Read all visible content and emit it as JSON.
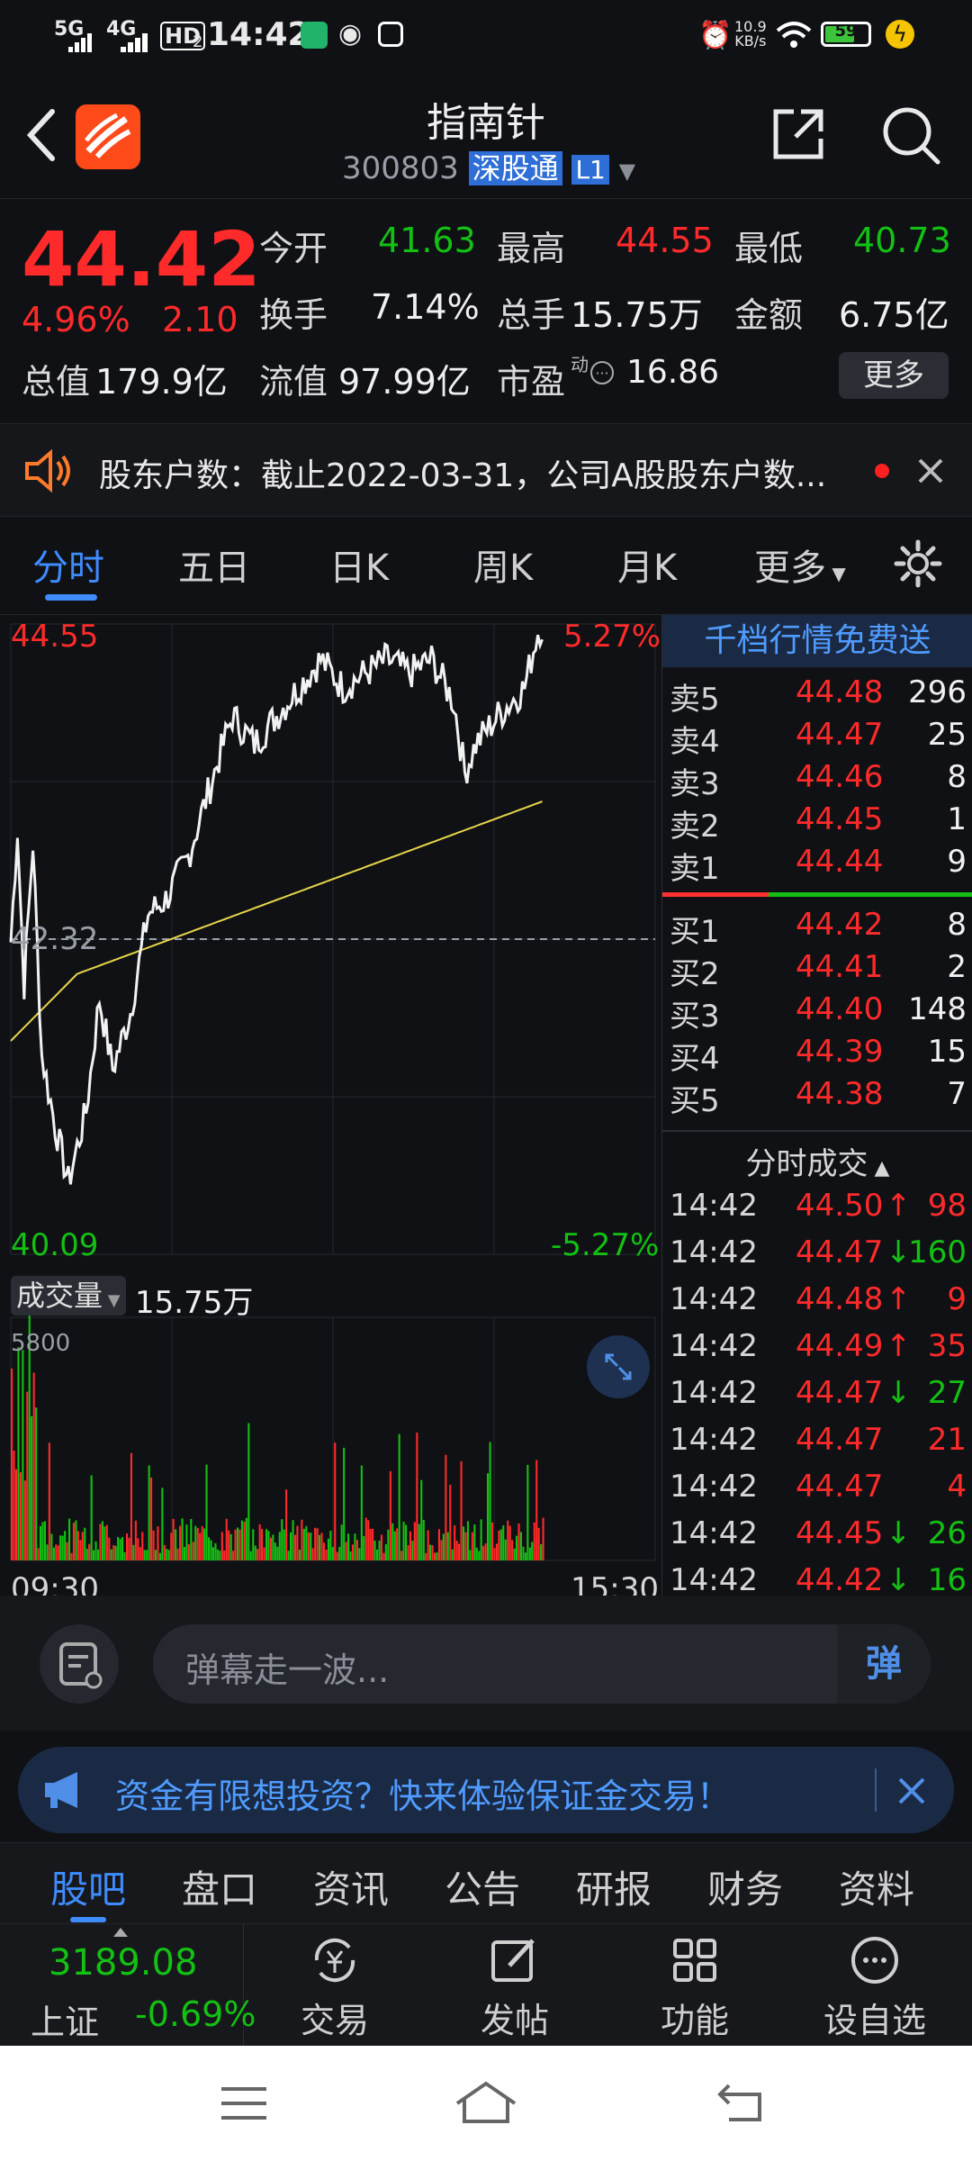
{
  "status": {
    "net1": "5G",
    "net2": "4G",
    "hd": "HD",
    "hd_sub": "2",
    "time": "14:42",
    "speed_value": "10.9",
    "speed_unit": "KB/s",
    "battery": "59"
  },
  "header": {
    "title": "指南针",
    "code": "300803",
    "market_badge": "深股通",
    "level_badge": "L1"
  },
  "quote": {
    "price": "44.42",
    "change_pct": "4.96%",
    "change_amt": "2.10",
    "open_label": "今开",
    "open": "41.63",
    "high_label": "最高",
    "high": "44.55",
    "low_label": "最低",
    "low": "40.73",
    "turnover_label": "换手",
    "turnover": "7.14%",
    "volume_label": "总手",
    "volume": "15.75万",
    "amount_label": "金额",
    "amount": "6.75亿",
    "mktcap_label": "总值",
    "mktcap": "179.9亿",
    "float_label": "流值",
    "float": "97.99亿",
    "pe_label": "市盈",
    "pe_sup": "动",
    "pe": "16.86",
    "more_label": "更多"
  },
  "notice": {
    "text": "股东户数：截止2022-03-31，公司A股股东户数..."
  },
  "tabs": [
    "分时",
    "五日",
    "日K",
    "周K",
    "月K",
    "更多"
  ],
  "chart": {
    "price_high": "44.55",
    "price_high_pct": "5.27%",
    "price_mid": "42.32",
    "price_low": "40.09",
    "price_low_pct": "-5.27%",
    "volume_label": "成交量",
    "volume_total": "15.75万",
    "volume_max": "5800",
    "time_start": "09:30",
    "time_end": "15:30"
  },
  "orderbook": {
    "title": "千档行情免费送",
    "asks": [
      {
        "name": "卖5",
        "price": "44.48",
        "vol": "296"
      },
      {
        "name": "卖4",
        "price": "44.47",
        "vol": "25"
      },
      {
        "name": "卖3",
        "price": "44.46",
        "vol": "8"
      },
      {
        "name": "卖2",
        "price": "44.45",
        "vol": "1"
      },
      {
        "name": "卖1",
        "price": "44.44",
        "vol": "9"
      }
    ],
    "bids": [
      {
        "name": "买1",
        "price": "44.42",
        "vol": "8"
      },
      {
        "name": "买2",
        "price": "44.41",
        "vol": "2"
      },
      {
        "name": "买3",
        "price": "44.40",
        "vol": "148"
      },
      {
        "name": "买4",
        "price": "44.39",
        "vol": "15"
      },
      {
        "name": "买5",
        "price": "44.38",
        "vol": "7"
      }
    ],
    "trades_title": "分时成交",
    "trades": [
      {
        "time": "14:42",
        "price": "44.50",
        "arrow": "↑",
        "vol": "98",
        "dir": "up"
      },
      {
        "time": "14:42",
        "price": "44.47",
        "arrow": "↓",
        "vol": "160",
        "dir": "down"
      },
      {
        "time": "14:42",
        "price": "44.48",
        "arrow": "↑",
        "vol": "9",
        "dir": "up"
      },
      {
        "time": "14:42",
        "price": "44.49",
        "arrow": "↑",
        "vol": "35",
        "dir": "up"
      },
      {
        "time": "14:42",
        "price": "44.47",
        "arrow": "↓",
        "vol": "27",
        "dir": "down"
      },
      {
        "time": "14:42",
        "price": "44.47",
        "arrow": "",
        "vol": "21",
        "dir": "up"
      },
      {
        "time": "14:42",
        "price": "44.47",
        "arrow": "",
        "vol": "4",
        "dir": "up"
      },
      {
        "time": "14:42",
        "price": "44.45",
        "arrow": "↓",
        "vol": "26",
        "dir": "down"
      },
      {
        "time": "14:42",
        "price": "44.42",
        "arrow": "↓",
        "vol": "16",
        "dir": "down"
      }
    ]
  },
  "comment": {
    "placeholder": "弹幕走一波...",
    "danmu_label": "弹"
  },
  "promo": {
    "text": "资金有限想投资？快来体验保证金交易！"
  },
  "bottom_tabs": [
    "股吧",
    "盘口",
    "资讯",
    "公告",
    "研报",
    "财务",
    "资料"
  ],
  "index": {
    "value": "3189.08",
    "name": "上证",
    "change": "-0.69%"
  },
  "toolbar": [
    "交易",
    "发帖",
    "功能",
    "设自选"
  ],
  "colors": {
    "up": "#ff2a2a",
    "down": "#13c013",
    "accent": "#3f8cff",
    "avg_line": "#e8d64a"
  }
}
